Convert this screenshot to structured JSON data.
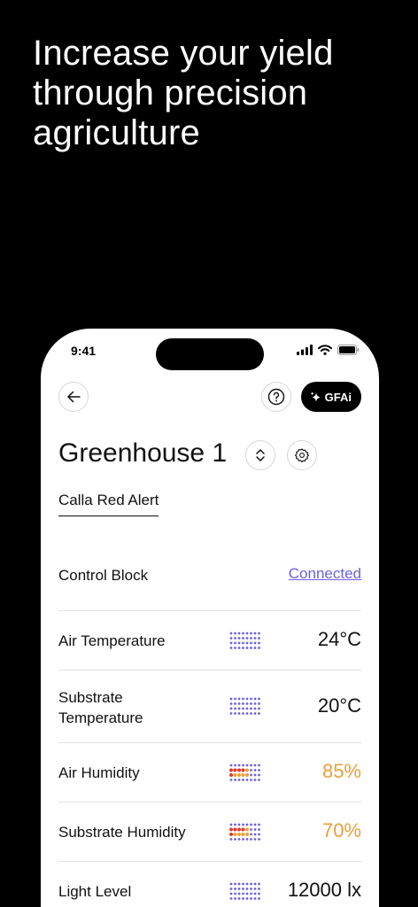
{
  "headline": "Increase your yield through precision agriculture",
  "status_bar": {
    "time": "9:41"
  },
  "nav": {
    "gfai_label": "GFAi"
  },
  "page_title": "Greenhouse 1",
  "tab": "Calla Red Alert",
  "control_block": {
    "label": "Control Block",
    "status": "Connected"
  },
  "metrics": [
    {
      "label": "Air Temperature",
      "value": "24°C",
      "status": "normal"
    },
    {
      "label": "Substrate Temperature",
      "value": "20°C",
      "status": "normal"
    },
    {
      "label": "Air Humidity",
      "value": "85%",
      "status": "warning"
    },
    {
      "label": "Substrate Humidity",
      "value": "70%",
      "status": "warning"
    },
    {
      "label": "Light Level",
      "value": "12000 lx",
      "status": "normal"
    }
  ],
  "colors": {
    "accent": "#6b61e0",
    "warning": "#e8a13a",
    "alert": "#e23b2e",
    "dot_normal": "#6b61e0"
  },
  "icons": [
    "back-arrow-icon",
    "help-icon",
    "sparkle-icon",
    "switch-icon",
    "gear-icon",
    "signal-icon",
    "wifi-icon",
    "battery-icon"
  ]
}
